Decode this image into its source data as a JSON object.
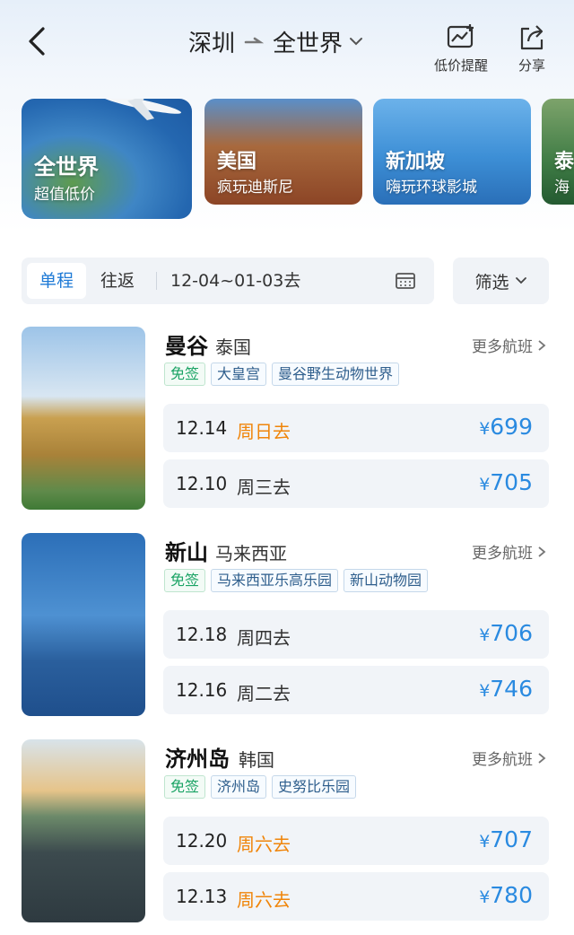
{
  "header": {
    "origin": "深圳",
    "destination": "全世界",
    "low_price_alert": "低价提醒",
    "share": "分享"
  },
  "destinations": [
    {
      "title": "全世界",
      "subtitle": "超值低价"
    },
    {
      "title": "美国",
      "subtitle": "疯玩迪斯尼"
    },
    {
      "title": "新加坡",
      "subtitle": "嗨玩环球影城"
    },
    {
      "title": "泰",
      "subtitle": "海"
    }
  ],
  "filter": {
    "one_way": "单程",
    "round_trip": "往返",
    "date_range": "12-04~01-03去",
    "filter_label": "筛选"
  },
  "more_flights": "更多航班",
  "currency": "¥",
  "items": [
    {
      "city": "曼谷",
      "country": "泰国",
      "tags": [
        "免签",
        "大皇宫",
        "曼谷野生动物世界"
      ],
      "flights": [
        {
          "date": "12.14",
          "day": "周日去",
          "price": "699"
        },
        {
          "date": "12.10",
          "day": "周三去",
          "price": "705"
        }
      ]
    },
    {
      "city": "新山",
      "country": "马来西亚",
      "tags": [
        "免签",
        "马来西亚乐高乐园",
        "新山动物园"
      ],
      "flights": [
        {
          "date": "12.18",
          "day": "周四去",
          "price": "706"
        },
        {
          "date": "12.16",
          "day": "周二去",
          "price": "746"
        }
      ]
    },
    {
      "city": "济州岛",
      "country": "韩国",
      "tags": [
        "免签",
        "济州岛",
        "史努比乐园"
      ],
      "flights": [
        {
          "date": "12.20",
          "day": "周六去",
          "price": "707"
        },
        {
          "date": "12.13",
          "day": "周六去",
          "price": "780"
        }
      ]
    }
  ],
  "colors": {
    "accent_blue": "#2a8ae0",
    "weekend_orange": "#f0850a",
    "visa_green": "#1aa364"
  }
}
